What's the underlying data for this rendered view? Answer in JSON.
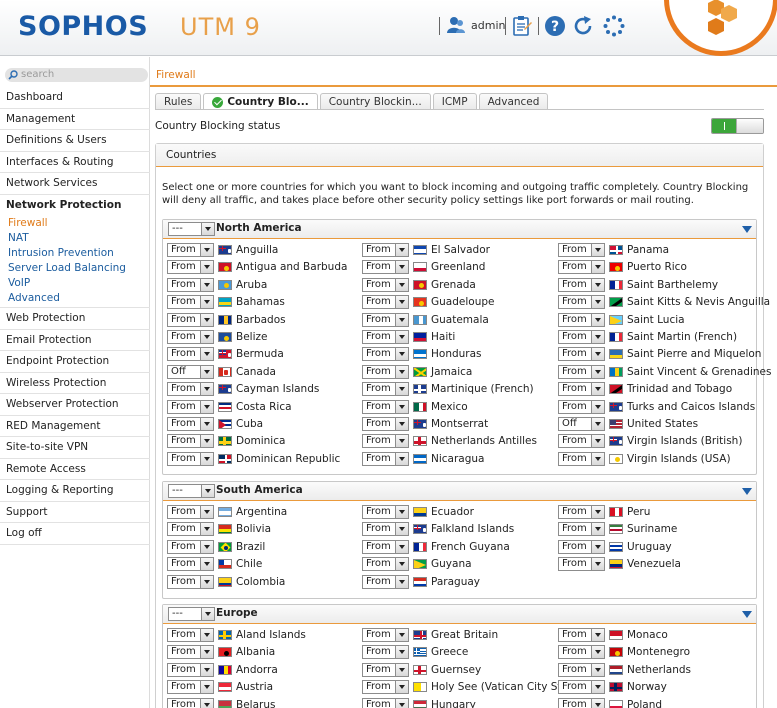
{
  "header": {
    "logo": "SOPHOS",
    "product": "UTM 9",
    "user": "admin",
    "icons": [
      "user-icon",
      "clipboard-icon",
      "help-icon",
      "refresh-icon",
      "spinner-icon"
    ],
    "accent": "#ea7a1e",
    "brand": "#1a5aa6"
  },
  "sidebar": {
    "search_placeholder": "search",
    "items_top": [
      "Dashboard",
      "Management",
      "Definitions & Users",
      "Interfaces & Routing",
      "Network Services"
    ],
    "section": "Network Protection",
    "sub_items": [
      {
        "label": "Firewall",
        "active": true
      },
      {
        "label": "NAT",
        "active": false
      },
      {
        "label": "Intrusion Prevention",
        "active": false
      },
      {
        "label": "Server Load Balancing",
        "active": false
      },
      {
        "label": "VoIP",
        "active": false
      },
      {
        "label": "Advanced",
        "active": false
      }
    ],
    "items_bottom": [
      "Web Protection",
      "Email Protection",
      "Endpoint Protection",
      "Wireless Protection",
      "Webserver Protection",
      "RED Management",
      "Site-to-site VPN",
      "Remote Access",
      "Logging & Reporting",
      "Support",
      "Log off"
    ]
  },
  "breadcrumb": "Firewall",
  "tabs": [
    {
      "label": "Rules",
      "active": false
    },
    {
      "label": "Country Blo...",
      "active": true
    },
    {
      "label": "Country Blockin...",
      "active": false
    },
    {
      "label": "ICMP",
      "active": false
    },
    {
      "label": "Advanced",
      "active": false
    }
  ],
  "status": {
    "label": "Country Blocking status",
    "enabled": true,
    "toggle_text": "I"
  },
  "countries": {
    "title": "Countries",
    "description": "Select one or more countries for which you want to block incoming and outgoing traffic completely. Country Blocking will deny all traffic, and takes place before other security policy settings like port forwards or mail routing."
  },
  "regions": [
    {
      "name": "North America",
      "selector": "---",
      "columns": [
        [
          {
            "value": "From",
            "country": "Anguilla",
            "flag": "anguilla"
          },
          {
            "value": "From",
            "country": "Antigua and Barbuda",
            "flag": "antigua"
          },
          {
            "value": "From",
            "country": "Aruba",
            "flag": "aruba"
          },
          {
            "value": "From",
            "country": "Bahamas",
            "flag": "bahamas"
          },
          {
            "value": "From",
            "country": "Barbados",
            "flag": "barbados"
          },
          {
            "value": "From",
            "country": "Belize",
            "flag": "belize"
          },
          {
            "value": "From",
            "country": "Bermuda",
            "flag": "bermuda"
          },
          {
            "value": "Off",
            "country": "Canada",
            "flag": "canada"
          },
          {
            "value": "From",
            "country": "Cayman Islands",
            "flag": "cayman"
          },
          {
            "value": "From",
            "country": "Costa Rica",
            "flag": "costarica"
          },
          {
            "value": "From",
            "country": "Cuba",
            "flag": "cuba"
          },
          {
            "value": "From",
            "country": "Dominica",
            "flag": "dominica"
          },
          {
            "value": "From",
            "country": "Dominican Republic",
            "flag": "domrep"
          }
        ],
        [
          {
            "value": "From",
            "country": "El Salvador",
            "flag": "elsalvador"
          },
          {
            "value": "From",
            "country": "Greenland",
            "flag": "greenland"
          },
          {
            "value": "From",
            "country": "Grenada",
            "flag": "grenada"
          },
          {
            "value": "From",
            "country": "Guadeloupe",
            "flag": "guadeloupe"
          },
          {
            "value": "From",
            "country": "Guatemala",
            "flag": "guatemala"
          },
          {
            "value": "From",
            "country": "Haiti",
            "flag": "haiti"
          },
          {
            "value": "From",
            "country": "Honduras",
            "flag": "honduras"
          },
          {
            "value": "From",
            "country": "Jamaica",
            "flag": "jamaica"
          },
          {
            "value": "From",
            "country": "Martinique (French)",
            "flag": "martinique"
          },
          {
            "value": "From",
            "country": "Mexico",
            "flag": "mexico"
          },
          {
            "value": "From",
            "country": "Montserrat",
            "flag": "montserrat"
          },
          {
            "value": "From",
            "country": "Netherlands Antilles",
            "flag": "antilles"
          },
          {
            "value": "From",
            "country": "Nicaragua",
            "flag": "nicaragua"
          }
        ],
        [
          {
            "value": "From",
            "country": "Panama",
            "flag": "panama"
          },
          {
            "value": "From",
            "country": "Puerto Rico",
            "flag": "puertorico"
          },
          {
            "value": "From",
            "country": "Saint Barthelemy",
            "flag": "french"
          },
          {
            "value": "From",
            "country": "Saint Kitts & Nevis Anguilla",
            "flag": "stkitts"
          },
          {
            "value": "From",
            "country": "Saint Lucia",
            "flag": "stlucia"
          },
          {
            "value": "From",
            "country": "Saint Martin (French)",
            "flag": "french"
          },
          {
            "value": "From",
            "country": "Saint Pierre and Miquelon",
            "flag": "stpierre"
          },
          {
            "value": "From",
            "country": "Saint Vincent & Grenadines",
            "flag": "stvincent"
          },
          {
            "value": "From",
            "country": "Trinidad and Tobago",
            "flag": "trinidad"
          },
          {
            "value": "From",
            "country": "Turks and Caicos Islands",
            "flag": "turks"
          },
          {
            "value": "Off",
            "country": "United States",
            "flag": "usa"
          },
          {
            "value": "From",
            "country": "Virgin Islands (British)",
            "flag": "bvi"
          },
          {
            "value": "From",
            "country": "Virgin Islands (USA)",
            "flag": "usvi"
          }
        ]
      ]
    },
    {
      "name": "South America",
      "selector": "---",
      "columns": [
        [
          {
            "value": "From",
            "country": "Argentina",
            "flag": "argentina"
          },
          {
            "value": "From",
            "country": "Bolivia",
            "flag": "bolivia"
          },
          {
            "value": "From",
            "country": "Brazil",
            "flag": "brazil"
          },
          {
            "value": "From",
            "country": "Chile",
            "flag": "chile"
          },
          {
            "value": "From",
            "country": "Colombia",
            "flag": "colombia"
          }
        ],
        [
          {
            "value": "From",
            "country": "Ecuador",
            "flag": "colombia"
          },
          {
            "value": "From",
            "country": "Falkland Islands",
            "flag": "falkland"
          },
          {
            "value": "From",
            "country": "French Guyana",
            "flag": "french"
          },
          {
            "value": "From",
            "country": "Guyana",
            "flag": "guyana"
          },
          {
            "value": "From",
            "country": "Paraguay",
            "flag": "paraguay"
          }
        ],
        [
          {
            "value": "From",
            "country": "Peru",
            "flag": "peru"
          },
          {
            "value": "From",
            "country": "Suriname",
            "flag": "suriname"
          },
          {
            "value": "From",
            "country": "Uruguay",
            "flag": "uruguay"
          },
          {
            "value": "From",
            "country": "Venezuela",
            "flag": "venezuela"
          }
        ]
      ]
    },
    {
      "name": "Europe",
      "selector": "---",
      "columns": [
        [
          {
            "value": "From",
            "country": "Aland Islands",
            "flag": "aland"
          },
          {
            "value": "From",
            "country": "Albania",
            "flag": "albania"
          },
          {
            "value": "From",
            "country": "Andorra",
            "flag": "andorra"
          },
          {
            "value": "From",
            "country": "Austria",
            "flag": "austria"
          },
          {
            "value": "From",
            "country": "Belarus",
            "flag": "belarus"
          }
        ],
        [
          {
            "value": "From",
            "country": "Great Britain",
            "flag": "gb"
          },
          {
            "value": "From",
            "country": "Greece",
            "flag": "greece"
          },
          {
            "value": "From",
            "country": "Guernsey",
            "flag": "guernsey"
          },
          {
            "value": "From",
            "country": "Holy See (Vatican City St...",
            "flag": "vatican"
          },
          {
            "value": "From",
            "country": "Hungary",
            "flag": "hungary"
          }
        ],
        [
          {
            "value": "From",
            "country": "Monaco",
            "flag": "monaco"
          },
          {
            "value": "From",
            "country": "Montenegro",
            "flag": "montenegro"
          },
          {
            "value": "From",
            "country": "Netherlands",
            "flag": "netherlands"
          },
          {
            "value": "From",
            "country": "Norway",
            "flag": "norway"
          },
          {
            "value": "From",
            "country": "Poland",
            "flag": "poland"
          }
        ]
      ]
    }
  ]
}
